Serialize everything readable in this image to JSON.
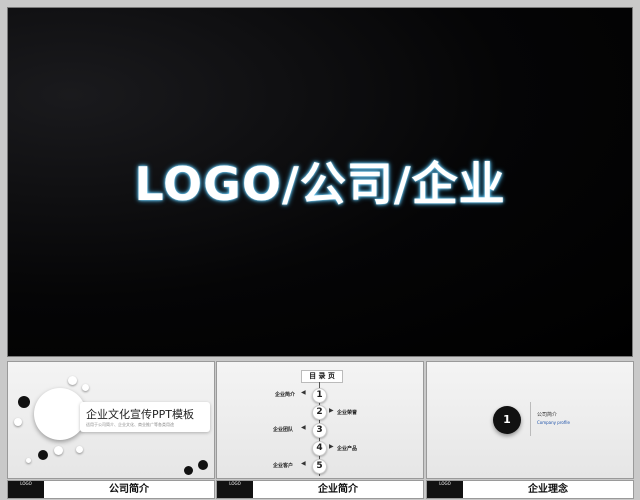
{
  "main_slide": {
    "title": "LOGO/公司/企业"
  },
  "thumbnails": [
    {
      "title": "企业文化宣传PPT模板",
      "subtitle": "适用于公司简介、企业文化、商业推广等各类用途",
      "bar": {
        "logo_text": "LOGO",
        "label": "公司简介"
      }
    },
    {
      "header": "目 录 页",
      "steps": [
        {
          "num": "1",
          "label": "企业简介"
        },
        {
          "num": "2",
          "label": "企业荣誉"
        },
        {
          "num": "3",
          "label": "企业团队"
        },
        {
          "num": "4",
          "label": "企业产品"
        },
        {
          "num": "5",
          "label": "企业客户"
        }
      ],
      "bar": {
        "logo_text": "LOGO",
        "label": "企业简介"
      }
    },
    {
      "number": "1",
      "label": "公司简介",
      "sub": "Company profile",
      "bar": {
        "logo_text": "LOGO",
        "label": "企业理念"
      }
    }
  ],
  "icons": {
    "brand": "apple-icon",
    "apple_glyph": ""
  },
  "colors": {
    "glow": "#3aa8e0",
    "dark": "#000000",
    "accent_blue": "#1a4fa8"
  }
}
